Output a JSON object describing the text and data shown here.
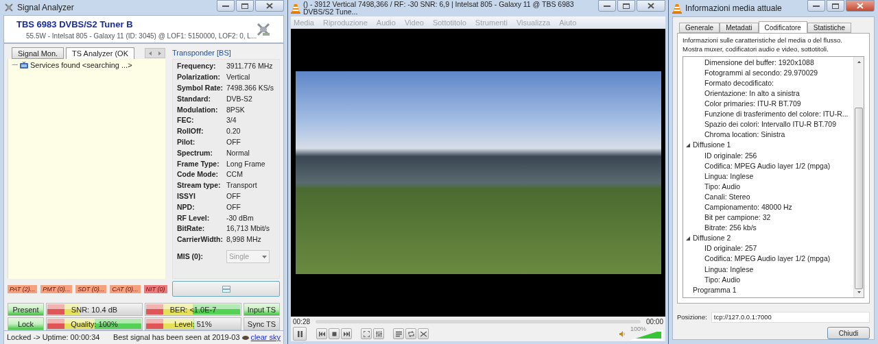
{
  "analyzer": {
    "title": "Signal Analyzer",
    "device": "TBS 6983 DVBS/S2 Tuner B",
    "subtitle": "55.5W - Intelsat 805 - Galaxy 11 (ID: 3045) @ LOF1: 5150000, LOF2: 0, L...",
    "tabs": [
      {
        "label": "Signal Mon.",
        "selected": false
      },
      {
        "label": "TS Analyzer (OK",
        "selected": true
      }
    ],
    "services_tree": [
      {
        "label": "Services found <searching ...>"
      }
    ],
    "tables": [
      {
        "label": "PAT (2)...",
        "color": "#f4a27e"
      },
      {
        "label": "PMT (0)...",
        "color": "#f4a27e"
      },
      {
        "label": "SDT (0)...",
        "color": "#f4a27e"
      },
      {
        "label": "CAT (0)...",
        "color": "#f4a27e"
      },
      {
        "label": "NIT (0)",
        "color": "#ec7a7a"
      }
    ],
    "transponder": {
      "title": "Transponder [BS]",
      "properties": [
        {
          "label": "Frequency:",
          "value": "3911.776 MHz"
        },
        {
          "label": "Polarization:",
          "value": "Vertical"
        },
        {
          "label": "Symbol Rate:",
          "value": "7498.366 KS/s"
        },
        {
          "label": "Standard:",
          "value": "DVB-S2"
        },
        {
          "label": "Modulation:",
          "value": "8PSK"
        },
        {
          "label": "FEC:",
          "value": "3/4"
        },
        {
          "label": "RollOff:",
          "value": "0.20"
        },
        {
          "label": "Pilot:",
          "value": "OFF"
        },
        {
          "label": "Spectrum:",
          "value": "Normal"
        },
        {
          "label": "Frame Type:",
          "value": "Long Frame"
        },
        {
          "label": "Code Mode:",
          "value": "CCM"
        },
        {
          "label": "Stream type:",
          "value": "Transport"
        },
        {
          "label": "ISSYI",
          "value": "OFF"
        },
        {
          "label": "NPD:",
          "value": "OFF"
        },
        {
          "label": "RF Level:",
          "value": "-30 dBm"
        },
        {
          "label": "BitRate:",
          "value": "16,713 Mbit/s"
        },
        {
          "label": "CarrierWidth:",
          "value": "8,998 MHz"
        }
      ],
      "mis": {
        "label": "MIS (0):",
        "value": "Single"
      }
    },
    "indicators": [
      {
        "label": "Present",
        "on": true
      },
      {
        "label": "Lock",
        "on": true
      },
      {
        "label": "Input TS",
        "on": true
      },
      {
        "label": "Sync TS",
        "on": false
      }
    ],
    "meters": [
      {
        "label": "SNR: 10.4 dB",
        "level": 0.34
      },
      {
        "label": "BER: <1.0E-7",
        "level": 1
      },
      {
        "label": "Quality: 100%",
        "level": 1
      },
      {
        "label": "Level: 51%",
        "level": 0.51
      }
    ],
    "status_bar": {
      "uptime": "Locked -> Uptime: 00:00:34",
      "best_signal": "Best signal has been seen at 2019-03",
      "link": "clear sky"
    }
  },
  "player": {
    "title": "() - 3912 Vertical 7498,366 / RF: -30 SNR: 6,9 | Intelsat 805 - Galaxy 11 @ TBS 6983 DVBS/S2 Tune...",
    "menu": [
      "Media",
      "Riproduzione",
      "Audio",
      "Video",
      "Sottotitolo",
      "Strumenti",
      "Visualizza",
      "Aiuto"
    ],
    "elapsed": "00:28",
    "remaining": "00:00",
    "volume": {
      "label": "100%",
      "level": 1
    }
  },
  "media_info": {
    "title": "Informazioni media attuale",
    "tabs": [
      {
        "label": "Generale",
        "selected": false
      },
      {
        "label": "Metadati",
        "selected": false
      },
      {
        "label": "Codificatore",
        "selected": true
      },
      {
        "label": "Statistiche",
        "selected": false
      }
    ],
    "description": "Informazioni sulle caratteristiche del media o del flusso.\nMostra muxer, codificatori audio e video, sottotitoli.",
    "tree": [
      {
        "children": [
          {
            "label": "Dimensione del buffer: 1920x1088"
          },
          {
            "label": "Fotogrammi al secondo: 29.970029"
          },
          {
            "label": "Formato decodificato:"
          },
          {
            "label": "Orientazione: In alto a sinistra"
          },
          {
            "label": "Color primaries: ITU-R BT.709"
          },
          {
            "label": "Funzione di trasferimento del colore: ITU-R..."
          },
          {
            "label": "Spazio dei colori: Intervallo ITU-R BT.709"
          },
          {
            "label": "Chroma location: Sinistra"
          }
        ]
      },
      {
        "label": "Diffusione 1",
        "expanded": true,
        "children": [
          {
            "label": "ID originale: 256"
          },
          {
            "label": "Codifica: MPEG Audio layer 1/2 (mpga)"
          },
          {
            "label": "Lingua: Inglese"
          },
          {
            "label": "Tipo: Audio"
          },
          {
            "label": "Canali: Stereo"
          },
          {
            "label": "Campionamento: 48000 Hz"
          },
          {
            "label": "Bit per campione: 32"
          },
          {
            "label": "Bitrate: 256 kb/s"
          }
        ]
      },
      {
        "label": "Diffusione 2",
        "expanded": true,
        "children": [
          {
            "label": "ID originale: 257"
          },
          {
            "label": "Codifica: MPEG Audio layer 1/2 (mpga)"
          },
          {
            "label": "Lingua: Inglese"
          },
          {
            "label": "Tipo: Audio"
          }
        ]
      },
      {
        "label": "Programma 1"
      }
    ],
    "location": {
      "label": "Posizione:",
      "value": "tcp://127.0.0.1:7000"
    },
    "close_button": "Chiudi"
  }
}
